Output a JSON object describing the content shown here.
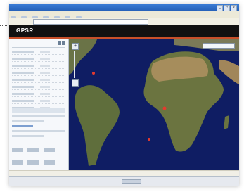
{
  "window": {
    "title_text": "",
    "buttons": [
      "_",
      "□",
      "×"
    ]
  },
  "browser": {
    "menu": [
      "",
      "",
      "",
      "",
      ""
    ],
    "address": ""
  },
  "app": {
    "logo": "GPSR",
    "subtitle": ""
  },
  "panel": {
    "header": ""
  },
  "map": {
    "zoom_in": "+",
    "zoom_out": "−",
    "markers": [
      "red-point-1",
      "red-point-2",
      "red-point-3"
    ]
  },
  "colors": {
    "ocean": "#0f1d63",
    "land": "#5d6b3a",
    "appbar": "#111111",
    "accent": "#c8502a",
    "marker": "#e53a2e"
  }
}
